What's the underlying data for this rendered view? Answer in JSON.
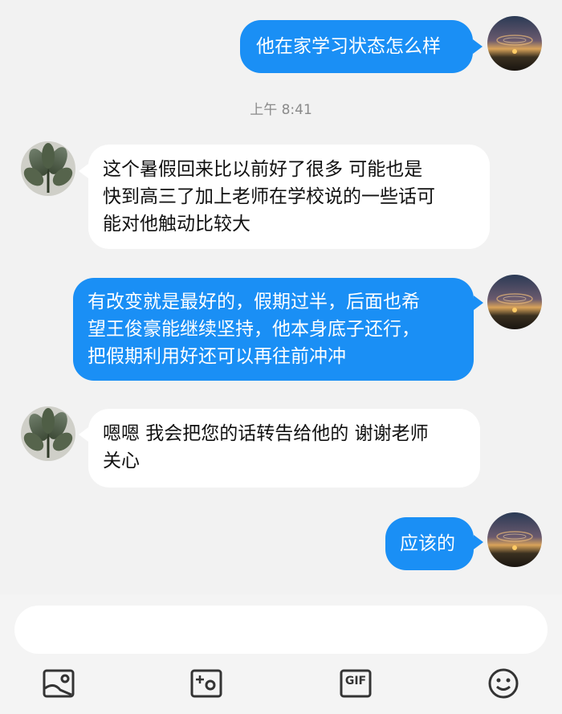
{
  "messages": [
    {
      "side": "out",
      "text": "他在家学习状态怎么样"
    },
    {
      "side": "in",
      "lines": [
        "这个暑假回来比以前好了很多 可能也是",
        "快到高三了加上老师在学校说的一些话可",
        "能对他触动比较大"
      ]
    },
    {
      "side": "out",
      "lines": [
        "有改变就是最好的，假期过半，后面也希",
        "望王俊豪能继续坚持，他本身底子还行，",
        "把假期利用好还可以再往前冲冲"
      ]
    },
    {
      "side": "in",
      "lines": [
        "嗯嗯 我会把您的话转告给他的 谢谢老师",
        "关心"
      ]
    },
    {
      "side": "out",
      "text": "应该的"
    }
  ],
  "timestamp": "上午 8:41",
  "composer": {
    "placeholder": ""
  },
  "toolbar": [
    {
      "icon": "image-icon"
    },
    {
      "icon": "camera-icon"
    },
    {
      "icon": "gif-icon",
      "label": "GIF"
    },
    {
      "icon": "emoji-icon"
    }
  ],
  "colors": {
    "outgoing": "#1a8ff5",
    "incoming": "#ffffff",
    "background": "#f2f2f2"
  }
}
